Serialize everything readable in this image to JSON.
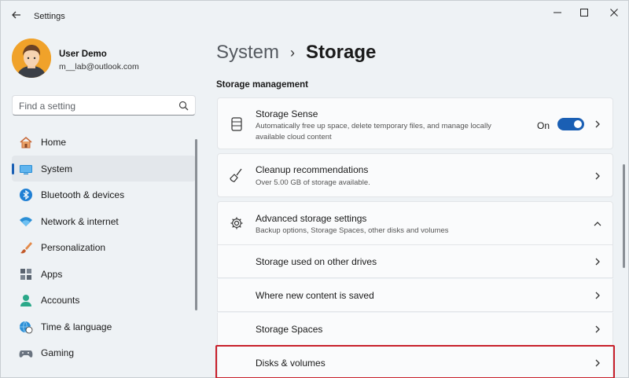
{
  "window": {
    "title": "Settings"
  },
  "profile": {
    "name": "User Demo",
    "email": "m__lab@outlook.com"
  },
  "search": {
    "placeholder": "Find a setting"
  },
  "nav": {
    "items": [
      {
        "label": "Home",
        "icon": "home-icon"
      },
      {
        "label": "System",
        "icon": "system-icon",
        "active": true
      },
      {
        "label": "Bluetooth & devices",
        "icon": "bluetooth-icon"
      },
      {
        "label": "Network & internet",
        "icon": "wifi-icon"
      },
      {
        "label": "Personalization",
        "icon": "brush-icon"
      },
      {
        "label": "Apps",
        "icon": "apps-icon"
      },
      {
        "label": "Accounts",
        "icon": "accounts-icon"
      },
      {
        "label": "Time & language",
        "icon": "globe-clock-icon"
      },
      {
        "label": "Gaming",
        "icon": "gamepad-icon"
      }
    ]
  },
  "breadcrumb": {
    "parent": "System",
    "separator": "›",
    "current": "Storage"
  },
  "section": {
    "title": "Storage management"
  },
  "cards": {
    "storage_sense": {
      "title": "Storage Sense",
      "description": "Automatically free up space, delete temporary files, and manage locally available cloud content",
      "toggle_label": "On",
      "toggle_on": true
    },
    "cleanup": {
      "title": "Cleanup recommendations",
      "description": "Over 5.00 GB of storage available."
    },
    "advanced": {
      "title": "Advanced storage settings",
      "description": "Backup options, Storage Spaces, other disks and volumes",
      "expanded": true,
      "sub_items": [
        {
          "label": "Storage used on other drives"
        },
        {
          "label": "Where new content is saved"
        },
        {
          "label": "Storage Spaces"
        },
        {
          "label": "Disks & volumes",
          "highlighted": true
        }
      ]
    }
  },
  "colors": {
    "accent": "#1a5fb4",
    "highlight": "#c8202b",
    "background": "#eef2f5",
    "card": "#fafbfc"
  }
}
